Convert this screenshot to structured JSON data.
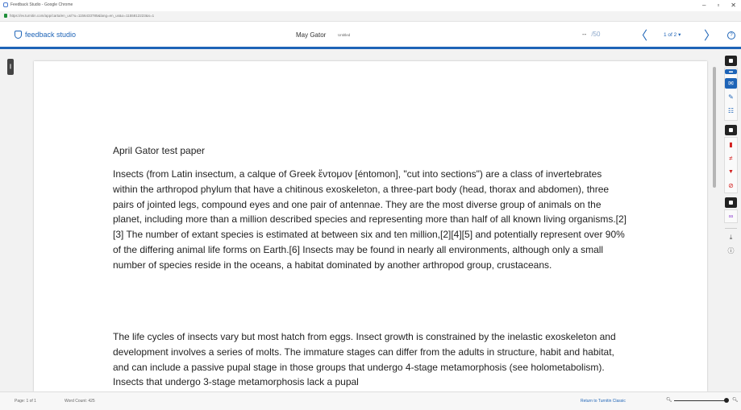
{
  "browser": {
    "window_title": "Feedback Studio - Google Chrome",
    "url": "https://ev.turnitin.com/app/carta/en_us/?u=1156433785&lang=en_us&o=1155812223&s=1",
    "minimize": "–",
    "maximize": "▫",
    "close": "✕"
  },
  "header": {
    "logo_text": "feedback studio",
    "student_name": "May Gator",
    "paper_title": "Untitled",
    "grade_value": "--",
    "grade_max": "/50",
    "prev_symbol": "〈",
    "page_selector": "1 of 2 ▾",
    "next_symbol": "〉",
    "help_symbol": "?"
  },
  "document": {
    "title": "April Gator test paper",
    "paragraphs": [
      "Insects (from Latin insectum, a calque of Greek ἔντομον [éntomon], \"cut into sections\") are a class of invertebrates within the arthropod phylum that have a chitinous exoskeleton, a three-part body (head, thorax and abdomen), three pairs of jointed legs, compound eyes and one pair of antennae. They are the most diverse group of animals on the planet, including more than a million described species and representing more than half of all known living organisms.[2][3] The number of extant species is estimated at between six and ten million,[2][4][5] and potentially represent over 90% of the differing animal life forms on Earth.[6] Insects may be found in nearly all environments, although only a small number of species reside in the oceans, a habitat dominated by another arthropod group, crustaceans.",
      "The life cycles of insects vary but most hatch from eggs. Insect growth is constrained by the inelastic exoskeleton and development involves a series of molts. The immature stages can differ from the adults in structure, habit and habitat, and can include a passive pupal stage in those groups that undergo 4-stage metamorphosis (see holometabolism). Insects that undergo 3-stage metamorphosis lack a pupal"
    ]
  },
  "side_panel_toggle": "❙",
  "tool_rail": {
    "icons": [
      {
        "name": "grading-layer-icon",
        "glyph": "▬",
        "color": "#1e64b7"
      },
      {
        "name": "comment-icon",
        "glyph": "✉",
        "color": "#1e64b7"
      },
      {
        "name": "feedback-summary-icon",
        "glyph": "✎",
        "color": "#1e64b7"
      },
      {
        "name": "rubric-icon",
        "glyph": "☷",
        "color": "#1e64b7"
      },
      {
        "name": "similarity-icon",
        "glyph": "▮",
        "color": "#d3201f"
      },
      {
        "name": "flags-icon",
        "glyph": "≠",
        "color": "#d3201f"
      },
      {
        "name": "filter-icon",
        "glyph": "▼",
        "color": "#d3201f"
      },
      {
        "name": "exclude-icon",
        "glyph": "⊘",
        "color": "#d3201f"
      },
      {
        "name": "link-icon",
        "glyph": "∞",
        "color": "#8b3bd0"
      },
      {
        "name": "download-icon",
        "glyph": "⤓",
        "color": "#555555"
      },
      {
        "name": "info-icon",
        "glyph": "ⓘ",
        "color": "#555555"
      }
    ]
  },
  "footer": {
    "page_count": "Page: 1 of 1",
    "word_count": "Word Count: 425",
    "return_link": "Return to Turnitin Classic",
    "zoom_out": "🔍︎",
    "zoom_in": "🔍︎"
  },
  "colors": {
    "accent": "#1e64b7",
    "similarity_red": "#d3201f",
    "purple": "#8b3bd0"
  }
}
